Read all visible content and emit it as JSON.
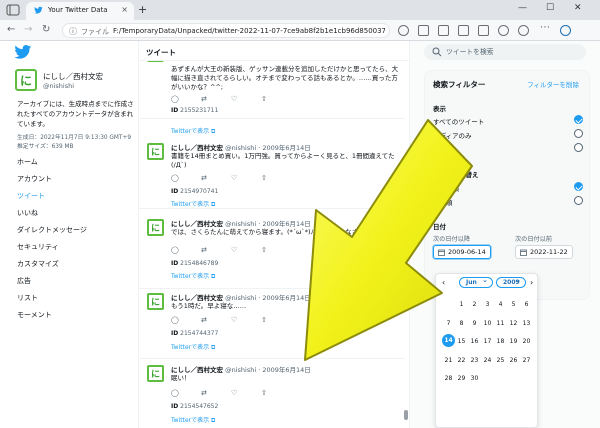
{
  "browser": {
    "tab_title": "Your Twitter Data",
    "tab_close": "×",
    "new_tab": "+",
    "url_label": "ファイル",
    "url": "F:/TemporaryData/Unpacked/twitter-2022-11-07-7ce9ab8f2b1e1cb96d8500378af0a7629...",
    "window_min": "—",
    "window_max": "☐",
    "window_close": "✕"
  },
  "profile": {
    "name": "にしし／西村文宏",
    "handle": "@nishishi",
    "avatar_letter": "に",
    "archive_desc": "アーカイブには、生成時点までに作成されたすべてのアカウントデータが含まれています。",
    "generated": "生成日：2022年11月7日 9:13:30 GMT+9",
    "size": "推定サイズ：639 MB"
  },
  "nav": [
    {
      "label": "ホーム",
      "active": false
    },
    {
      "label": "アカウント",
      "active": false
    },
    {
      "label": "ツイート",
      "active": true
    },
    {
      "label": "いいね",
      "active": false
    },
    {
      "label": "ダイレクトメッセージ",
      "active": false
    },
    {
      "label": "セキュリティ",
      "active": false
    },
    {
      "label": "カスタマイズ",
      "active": false
    },
    {
      "label": "広告",
      "active": false
    },
    {
      "label": "リスト",
      "active": false
    },
    {
      "label": "モーメント",
      "active": false
    }
  ],
  "center": {
    "title": "ツイート",
    "id_prefix": "ID",
    "show_link": "Twitterで表示 ⧉",
    "tweets": [
      {
        "name": "にしし／西村文宏",
        "meta": "@nishishi · 2009年6月14日",
        "text": "あずまんが大王の新装版、ゲッサン連載分を追加しただけかと思ってたら、大幅に描き直されてるらしい。オチまで変わってる話もあるとか。……買った方がいいかな？^^;",
        "id": "2155231711"
      },
      {
        "name": "にしし／西村文宏",
        "meta": "@nishishi · 2009年6月14日",
        "text": "書籍を14冊まとめ買い。1万円強。買ってからよーく見ると、1冊間違えてた\n(/Д`)",
        "id": "2154970741"
      },
      {
        "name": "にしし／西村文宏",
        "meta": "@nishishi · 2009年6月14日",
        "text": "では、さくらたんに萌えてから寝ます。(*´ω`*)ﾉｼ おやすみなさい。",
        "id": "2154846789"
      },
      {
        "name": "にしし／西村文宏",
        "meta": "@nishishi · 2009年6月14日",
        "text": "もう1時だ。早よ寝な……",
        "id": "2154744377"
      },
      {
        "name": "にしし／西村文宏",
        "meta": "@nishishi · 2009年6月14日",
        "text": "眠い！",
        "id": "2154547652"
      }
    ]
  },
  "right": {
    "search_placeholder": "ツイートを検索",
    "filter_title": "検索フィルター",
    "filter_reset": "フィルターを削除",
    "display_section": "表示",
    "display_options": [
      {
        "label": "すべてのツイート",
        "checked": true
      },
      {
        "label": "メディアのみ",
        "checked": false
      },
      {
        "label": "",
        "checked": false
      }
    ],
    "sort_section": "日付で並べ替え",
    "sort_options": [
      {
        "label": "新しい順",
        "checked": true
      },
      {
        "label": "古い順",
        "checked": false
      }
    ],
    "date_section": "日付",
    "from_label": "次の日付以降",
    "to_label": "次の日付以前",
    "from_value": "2009-06-14",
    "to_value": "2022-11-22"
  },
  "calendar": {
    "prev": "‹",
    "next": "›",
    "month": "Jun",
    "year": "2009",
    "weeks": [
      [
        "",
        "1",
        "2",
        "3",
        "4",
        "5",
        "6"
      ],
      [
        "7",
        "8",
        "9",
        "10",
        "11",
        "12",
        "13"
      ],
      [
        "14",
        "15",
        "16",
        "17",
        "18",
        "19",
        "20"
      ],
      [
        "21",
        "22",
        "23",
        "24",
        "25",
        "26",
        "27"
      ],
      [
        "28",
        "29",
        "30",
        "",
        "",
        "",
        ""
      ]
    ],
    "selected": "14"
  },
  "colors": {
    "accent": "#1d9bf0",
    "arrow_fill": "#f2f21a",
    "arrow_edge": "#8c8c0a"
  }
}
